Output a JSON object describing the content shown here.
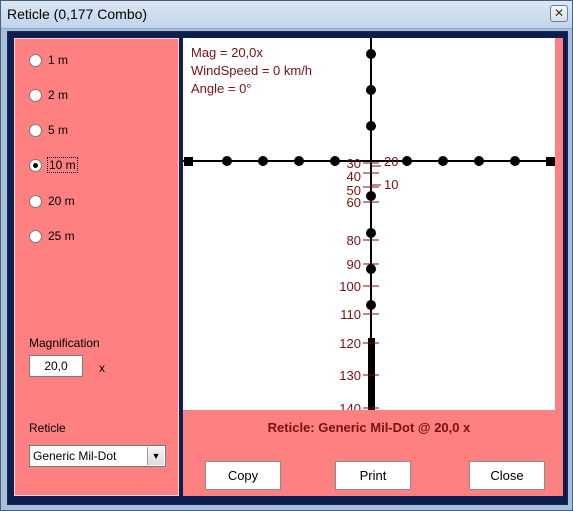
{
  "window": {
    "title": "Reticle (0,177 Combo)",
    "close_glyph": "✕"
  },
  "distances": [
    {
      "label": "1 m",
      "checked": false
    },
    {
      "label": "2 m",
      "checked": false
    },
    {
      "label": "5 m",
      "checked": false
    },
    {
      "label": "10 m",
      "checked": true
    },
    {
      "label": "20 m",
      "checked": false
    },
    {
      "label": "25 m",
      "checked": false
    }
  ],
  "magnification": {
    "label": "Magnification",
    "value": "20,0",
    "unit": "x"
  },
  "reticle": {
    "label": "Reticle",
    "selected": "Generic Mil-Dot"
  },
  "scope": {
    "info": [
      "Mag = 20,0x",
      "WindSpeed = 0 km/h",
      "Angle = 0°"
    ],
    "range_labels": [
      "30",
      "40",
      "50",
      "60",
      "80",
      "90",
      "100",
      "110",
      "120",
      "130",
      "140"
    ],
    "side_labels": [
      "20",
      "10"
    ],
    "caption": "Reticle: Generic Mil-Dot @ 20,0 x"
  },
  "buttons": {
    "copy": "Copy",
    "print": "Print",
    "close": "Close"
  },
  "colors": {
    "panel": "#ff8080",
    "frame": "#0c1f4e",
    "label_text": "#7a1010"
  }
}
